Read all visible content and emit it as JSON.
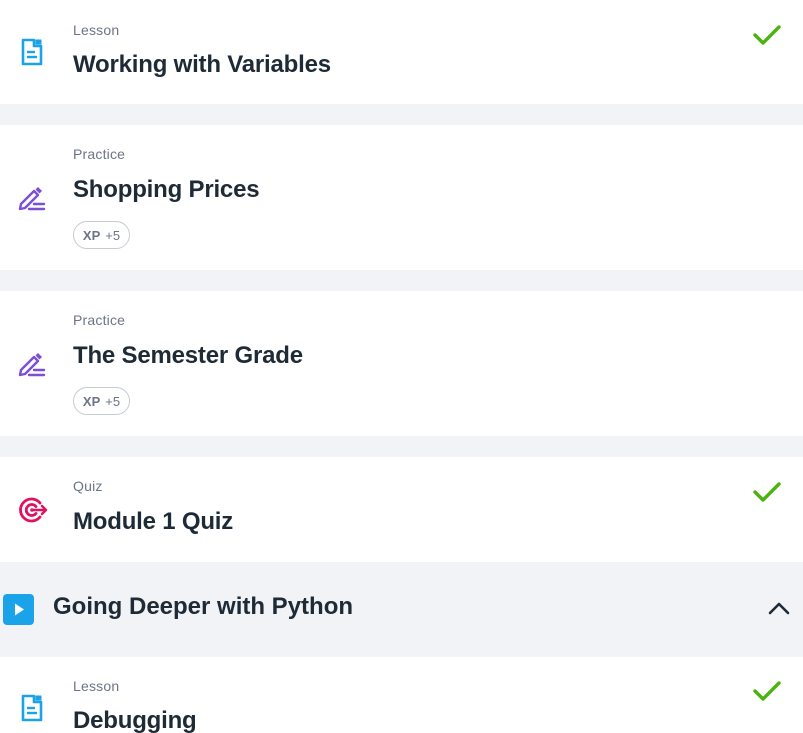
{
  "items": [
    {
      "kind": "Lesson",
      "title": "Working with Variables",
      "completed": true,
      "icon": "lesson-document-icon"
    },
    {
      "kind": "Practice",
      "title": "Shopping Prices",
      "xp_label": "XP",
      "xp_value": "+5",
      "icon": "practice-pencil-icon"
    },
    {
      "kind": "Practice",
      "title": "The Semester Grade",
      "xp_label": "XP",
      "xp_value": "+5",
      "icon": "practice-pencil-icon"
    },
    {
      "kind": "Quiz",
      "title": "Module 1 Quiz",
      "completed": true,
      "icon": "quiz-target-icon"
    }
  ],
  "section": {
    "title": "Going Deeper with Python",
    "expanded": true,
    "icon": "play-icon"
  },
  "section_items": [
    {
      "kind": "Lesson",
      "title": "Debugging",
      "completed": true,
      "icon": "lesson-document-icon"
    }
  ],
  "colors": {
    "lesson_icon": "#1aa3e8",
    "practice_icon": "#7b4fd6",
    "quiz_icon": "#e0115f",
    "check": "#4bb30f",
    "page_background": "#f1f3f6",
    "title_text": "#1e2a36",
    "muted_text": "#6d7487"
  }
}
